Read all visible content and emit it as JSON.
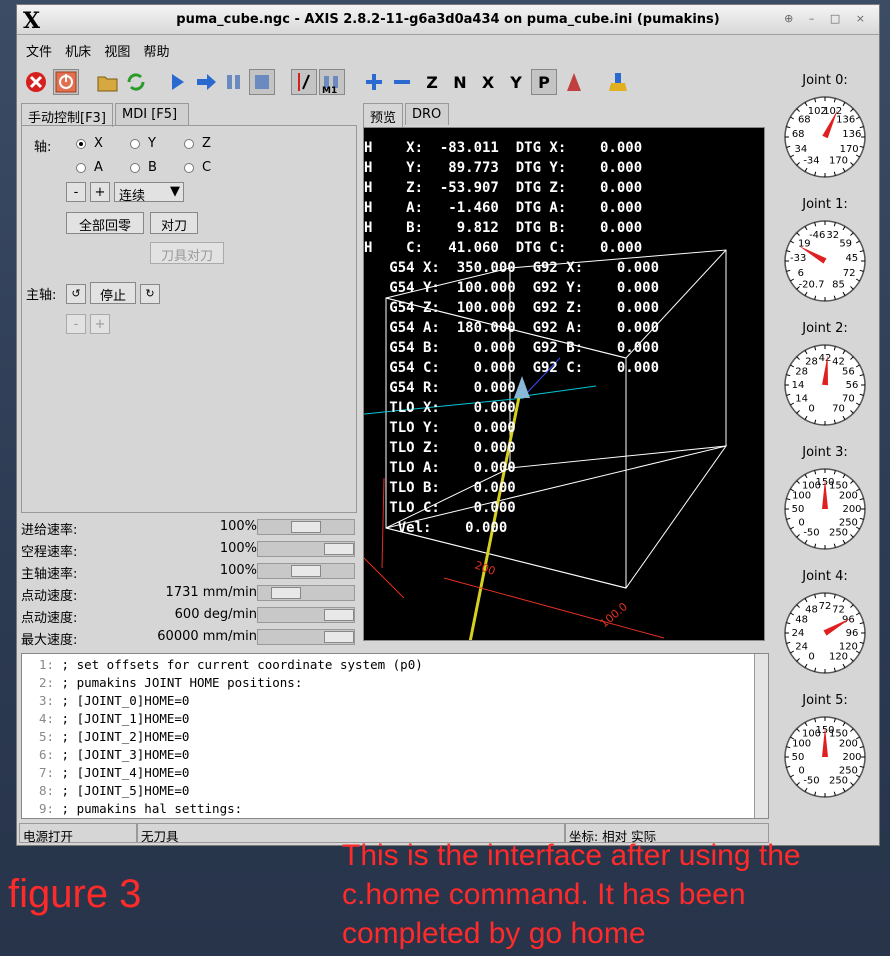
{
  "window": {
    "title": "puma_cube.ngc - AXIS 2.8.2-11-g6a3d0a434 on puma_cube.ini (pumakins)",
    "logo": "X",
    "controls": "⊕ – □ ×"
  },
  "menu": {
    "file": "文件",
    "machine": "机床",
    "view": "视图",
    "help": "帮助"
  },
  "toolbar": {
    "icons": [
      "estop-icon",
      "power-icon",
      "open-file-icon",
      "reload-icon",
      "run-icon",
      "step-icon",
      "pause-icon",
      "stop-icon",
      "skip-blocks-icon",
      "optional-stop-icon",
      "zoom-in-icon",
      "zoom-out-icon",
      "view-z-icon",
      "view-z2-icon",
      "view-x-icon",
      "view-y-icon",
      "view-p-icon",
      "rotate-icon",
      "clear-plot-icon"
    ],
    "view_z": "Z",
    "view_x": "X",
    "view_y": "Y",
    "view_p": "P",
    "optional_stop": "M1"
  },
  "left_tabs": {
    "manual": "手动控制[F3]",
    "mdi": "MDI [F5]"
  },
  "manual": {
    "axis_label": "轴:",
    "axes": [
      {
        "name": "X",
        "selected": true
      },
      {
        "name": "Y",
        "selected": false
      },
      {
        "name": "Z",
        "selected": false
      },
      {
        "name": "A",
        "selected": false
      },
      {
        "name": "B",
        "selected": false
      },
      {
        "name": "C",
        "selected": false
      }
    ],
    "minus": "-",
    "plus": "+",
    "jog_mode": "连续",
    "home_all": "全部回零",
    "touch_off": "对刀",
    "tool_touch_off": "刀具对刀",
    "spindle_label": "主轴:",
    "spindle_stop": "停止",
    "spindle_minus": "-",
    "spindle_plus": "+"
  },
  "rates": [
    {
      "label": "进给速率:",
      "value": "100%",
      "fill": 0.5
    },
    {
      "label": "空程速率:",
      "value": "100%",
      "fill": 1.0
    },
    {
      "label": "主轴速率:",
      "value": "100%",
      "fill": 0.5
    },
    {
      "label": "点动速度:",
      "value": "1731 mm/min",
      "fill": 0.2
    },
    {
      "label": "点动速度:",
      "value": "600 deg/min",
      "fill": 1.0
    },
    {
      "label": "最大速度:",
      "value": "60000 mm/min",
      "fill": 1.0
    }
  ],
  "right_tabs": {
    "preview": "预览",
    "dro": "DRO"
  },
  "dro_lines": [
    "H    X:  -83.011  DTG X:    0.000",
    "H    Y:   89.773  DTG Y:    0.000",
    "H    Z:  -53.907  DTG Z:    0.000",
    "H    A:   -1.460  DTG A:    0.000",
    "H    B:    9.812  DTG B:    0.000",
    "H    C:   41.060  DTG C:    0.000",
    "   G54 X:  350.000  G92 X:    0.000",
    "   G54 Y:  100.000  G92 Y:    0.000",
    "   G54 Z:  100.000  G92 Z:    0.000",
    "   G54 A:  180.000  G92 A:    0.000",
    "   G54 B:    0.000  G92 B:    0.000",
    "   G54 C:    0.000  G92 C:    0.000",
    "   G54 R:    0.000",
    "   TLO X:    0.000",
    "   TLO Y:    0.000",
    "   TLO Z:    0.000",
    "   TLO A:    0.000",
    "   TLO B:    0.000",
    "   TLO C:    0.000",
    "    Vel:    0.000"
  ],
  "preview_labels": {
    "dim_x": "100.0",
    "dim_y": "200"
  },
  "gcode": [
    {
      "n": "1:",
      "text": "; set offsets for current coordinate system (p0)"
    },
    {
      "n": "2:",
      "text": "; pumakins JOINT HOME positions:"
    },
    {
      "n": "3:",
      "text": ";    [JOINT_0]HOME=0"
    },
    {
      "n": "4:",
      "text": ";    [JOINT_1]HOME=0"
    },
    {
      "n": "5:",
      "text": ";    [JOINT_2]HOME=0"
    },
    {
      "n": "6:",
      "text": ";    [JOINT_3]HOME=0"
    },
    {
      "n": "7:",
      "text": ";    [JOINT_4]HOME=0"
    },
    {
      "n": "8:",
      "text": ";    [JOINT_5]HOME=0"
    },
    {
      "n": "9:",
      "text": "; pumakins hal settings:"
    }
  ],
  "status": {
    "power": "电源打开",
    "tool": "无刀具",
    "coords": "坐标: 相对 实际"
  },
  "joints": [
    {
      "label": "Joint 0:",
      "ticks": [
        "-34",
        "34",
        "68",
        "68",
        "102",
        "102",
        "136",
        "136",
        "170",
        "170"
      ],
      "angle": 25
    },
    {
      "label": "Joint 1:",
      "ticks": [
        "-20.7",
        "6",
        "-33",
        "19",
        "-46",
        "32",
        "59",
        "45",
        "72",
        "85"
      ],
      "angle": -60
    },
    {
      "label": "Joint 2:",
      "ticks": [
        "0",
        "14",
        "14",
        "28",
        "28",
        "42",
        "42",
        "56",
        "56",
        "70",
        "70"
      ],
      "angle": 5
    },
    {
      "label": "Joint 3:",
      "ticks": [
        "-50",
        "0",
        "50",
        "100",
        "100",
        "150",
        "150",
        "200",
        "200",
        "250",
        "250"
      ],
      "angle": 0
    },
    {
      "label": "Joint 4:",
      "ticks": [
        "0",
        "24",
        "24",
        "48",
        "48",
        "72",
        "72",
        "96",
        "96",
        "120",
        "120"
      ],
      "angle": 60
    },
    {
      "label": "Joint 5:",
      "ticks": [
        "-50",
        "0",
        "50",
        "100",
        "100",
        "150",
        "150",
        "200",
        "200",
        "250",
        "250"
      ],
      "angle": 0
    }
  ],
  "annotations": {
    "figure": "figure 3",
    "caption_1": "This is the interface after using the",
    "caption_2": "c.home command. It has been",
    "caption_3": "completed by go home"
  }
}
